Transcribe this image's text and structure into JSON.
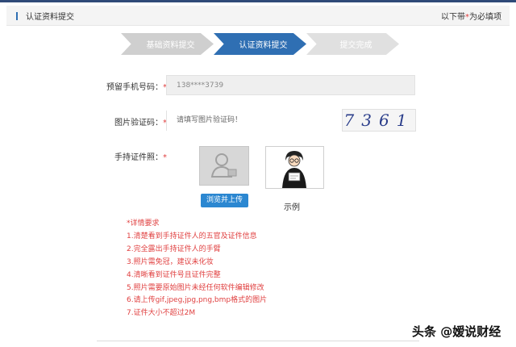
{
  "header": {
    "title": "认证资料提交",
    "note_prefix": "以下带",
    "note_star": "*",
    "note_suffix": "为必填项"
  },
  "steps": [
    {
      "label": "基础资料提交",
      "state": "done"
    },
    {
      "label": "认证资料提交",
      "state": "active"
    },
    {
      "label": "提交完成",
      "state": "todo"
    }
  ],
  "form": {
    "phone": {
      "label": "预留手机号码：",
      "required_mark": "*",
      "value": "138****3739"
    },
    "captcha": {
      "label": "图片验证码：",
      "required_mark": "*",
      "placeholder": "请填写图片验证码！",
      "image_text": "7361"
    },
    "id_photo": {
      "label": "手持证件照：",
      "required_mark": "*",
      "upload_button": "浏览并上传",
      "example_label": "示例"
    }
  },
  "requirements": {
    "title": "*详情要求",
    "items": [
      "1.清楚看到手持证件人的五官及证件信息",
      "2.完全露出手持证件人的手臂",
      "3.照片需免冠，建议未化妆",
      "4.清晰看到证件号且证件完整",
      "5.照片需要原始图片未经任何软件编辑修改",
      "6.请上传gif,jpeg,jpg,png,bmp格式的图片",
      "7.证件大小不超过2M"
    ]
  },
  "watermark": "头条 @嫒说财经",
  "colors": {
    "accent": "#2f6fb3",
    "required": "#e04040",
    "upload_button": "#2b87d1"
  }
}
